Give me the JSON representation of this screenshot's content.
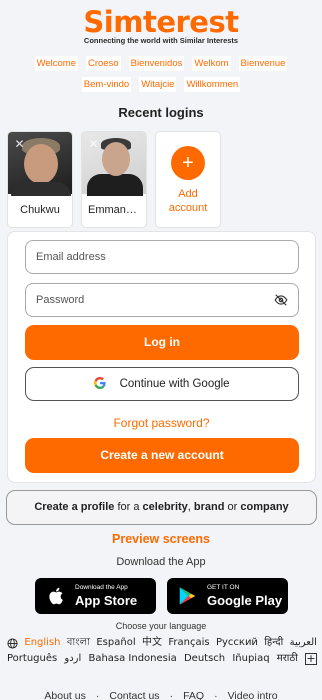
{
  "brand": {
    "name": "Simterest",
    "tagline": "Connecting the world with Similar Interests",
    "accent": "#ff6a00"
  },
  "greetings": [
    "Welcome",
    "Croeso",
    "Bienvenidos",
    "Welkom",
    "Bienvenue",
    "Bem-vindo",
    "Witajcie",
    "Willkommen"
  ],
  "recent": {
    "title": "Recent logins",
    "users": [
      {
        "name": "Chukwu"
      },
      {
        "name": "Emmanuel"
      }
    ],
    "add_label": "Add account"
  },
  "form": {
    "email_placeholder": "Email address",
    "password_placeholder": "Password",
    "login_label": "Log in",
    "google_label": "Continue with Google",
    "forgot_label": "Forgot password?",
    "create_label": "Create a new account"
  },
  "profile": {
    "prefix": "Create a profile",
    "mid1": " for a ",
    "celebrity": "celebrity",
    "comma": ", ",
    "brand": "brand",
    "or": " or ",
    "company": "company"
  },
  "preview_label": "Preview screens",
  "download_label": "Download the App",
  "apple": {
    "small": "Download the App",
    "big": "App Store"
  },
  "google_play": {
    "small": "GET IT ON",
    "big": "Google Play"
  },
  "choose_language": "Choose your language",
  "languages_row1": [
    "English",
    "বাংলা",
    "Español",
    "中文",
    "Français",
    "Русский",
    "हिन्दी",
    "العربية"
  ],
  "languages_row2": [
    "Português",
    "اردو",
    "Bahasa Indonesia",
    "Deutsch",
    "Iñupiaq",
    "मराठी"
  ],
  "footer": [
    "About us",
    "Contact us",
    "FAQ",
    "Video intro"
  ],
  "icons": {
    "globe": "globe-icon",
    "plus": "plus-icon",
    "eye_off": "eye-off-icon",
    "google": "google-icon",
    "apple": "apple-icon",
    "play": "play-store-icon",
    "close": "close-icon"
  }
}
